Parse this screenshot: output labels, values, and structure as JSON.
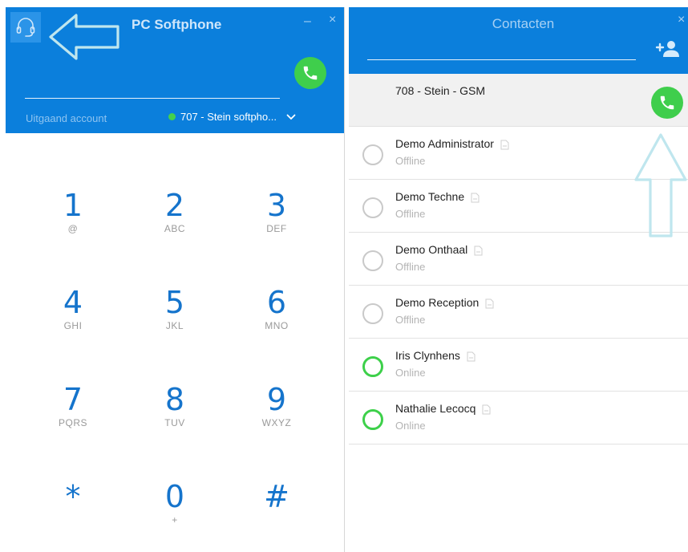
{
  "softphone": {
    "title": "PC Softphone",
    "minimize_glyph": "–",
    "close_glyph": "×",
    "dial_value": "",
    "account_label": "Uitgaand account",
    "account_value": "707 - Stein softpho...",
    "account_status_color": "#44d04c",
    "icons": {
      "headset": "headset-icon",
      "call": "phone-icon",
      "dropdown": "chevron-down-icon",
      "annotation": "arrow-left-outline"
    },
    "keys": [
      {
        "digit": "1",
        "letters": "@"
      },
      {
        "digit": "2",
        "letters": "ABC"
      },
      {
        "digit": "3",
        "letters": "DEF"
      },
      {
        "digit": "4",
        "letters": "GHI"
      },
      {
        "digit": "5",
        "letters": "JKL"
      },
      {
        "digit": "6",
        "letters": "MNO"
      },
      {
        "digit": "7",
        "letters": "PQRS"
      },
      {
        "digit": "8",
        "letters": "TUV"
      },
      {
        "digit": "9",
        "letters": "WXYZ"
      },
      {
        "digit": "*",
        "letters": ""
      },
      {
        "digit": "0",
        "letters": "+"
      },
      {
        "digit": "#",
        "letters": ""
      }
    ]
  },
  "contacts": {
    "title": "Contacten",
    "close_glyph": "×",
    "search_value": "",
    "icons": {
      "add_contact": "add-contact-icon",
      "call": "phone-icon",
      "note": "note-icon",
      "annotation": "arrow-up-outline"
    },
    "colors": {
      "header": "#0b7fdc",
      "online": "#3dd04a",
      "offline": "#c9c9c9",
      "call_button": "#3fce4c"
    },
    "selected": {
      "name": "708 - Stein - GSM"
    },
    "items": [
      {
        "name": "Demo  Administrator",
        "status": "Offline"
      },
      {
        "name": "Demo  Techne",
        "status": "Offline"
      },
      {
        "name": "Demo Onthaal",
        "status": "Offline"
      },
      {
        "name": "Demo Reception",
        "status": "Offline"
      },
      {
        "name": "Iris Clynhens",
        "status": "Online"
      },
      {
        "name": "Nathalie Lecocq",
        "status": "Online"
      }
    ]
  }
}
